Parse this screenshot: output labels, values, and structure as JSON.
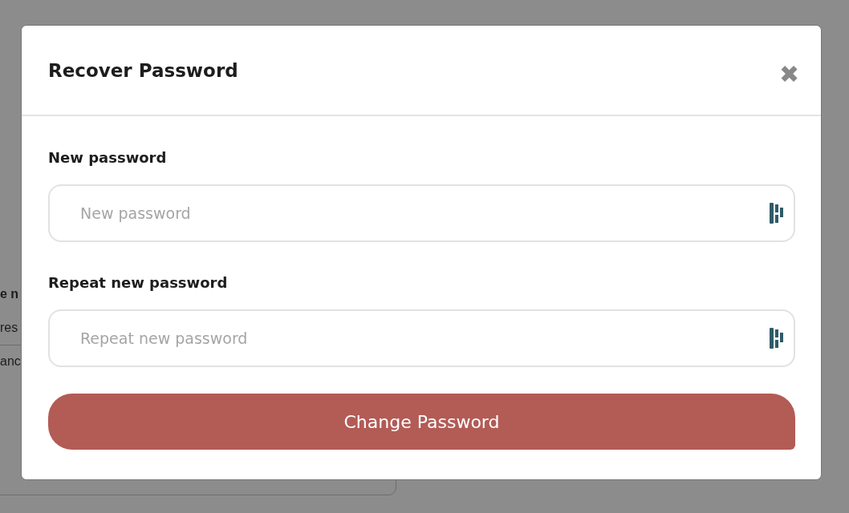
{
  "background": {
    "heading": "e n",
    "lines": [
      "res",
      "anc"
    ]
  },
  "dialog": {
    "title": "Recover Password",
    "close": "✖",
    "fields": [
      {
        "label": "New password",
        "placeholder": "New password"
      },
      {
        "label": "Repeat new password",
        "placeholder": "Repeat new password"
      }
    ],
    "submit": "Change Password"
  }
}
